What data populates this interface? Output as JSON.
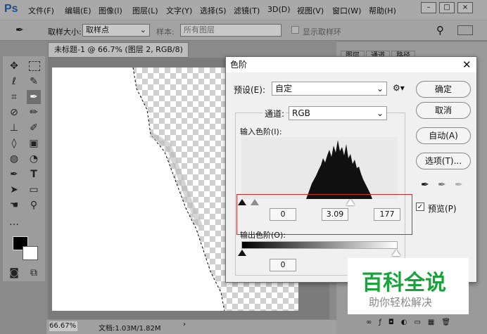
{
  "app": {
    "logo": "Ps"
  },
  "menu": [
    "文件(F)",
    "编辑(E)",
    "图像(I)",
    "图层(L)",
    "文字(Y)",
    "选择(S)",
    "滤镜(T)",
    "3D(D)",
    "视图(V)",
    "窗口(W)",
    "帮助(H)"
  ],
  "window_controls": [
    "–",
    "□",
    "×"
  ],
  "options": {
    "sample_size_label": "取样大小:",
    "sample_size_value": "取样点",
    "sample_label": "样本:",
    "sample_value": "所有图层",
    "show_ring": "显示取样环"
  },
  "document": {
    "tab_title": "未标题-1 @ 66.7% (图层 2, RGB/8) *",
    "zoom": "66.67%",
    "doc_info": "文档:1.03M/1.82M"
  },
  "panel_tabs": [
    "图层",
    "通道",
    "路径"
  ],
  "levels": {
    "title": "色阶",
    "preset_label": "预设(E):",
    "preset_value": "自定",
    "channel_label": "通道:",
    "channel_value": "RGB",
    "input_label": "输入色阶(I):",
    "input_black": "0",
    "input_gamma": "3.09",
    "input_white": "177",
    "output_label": "输出色阶(O):",
    "output_black": "0",
    "btn_ok": "确定",
    "btn_cancel": "取消",
    "btn_auto": "自动(A)",
    "btn_options": "选项(T)...",
    "preview_label": "预览(P)",
    "preview_checked": true
  },
  "watermark": {
    "title": "百科全说",
    "subtitle": "助你轻松解决"
  }
}
